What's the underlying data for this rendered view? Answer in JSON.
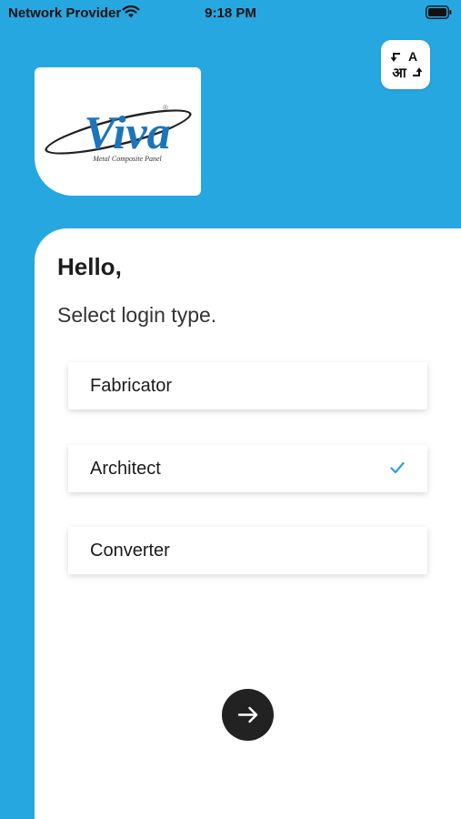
{
  "status_bar": {
    "carrier": "Network Provider",
    "time": "9:18 PM"
  },
  "colors": {
    "brand_blue": "#27a7e0",
    "check_blue": "#2e9ee0",
    "dark_button": "#222222"
  },
  "language_toggle": {
    "icon": "translate-icon",
    "glyph_latin": "A",
    "glyph_devanagari": "आ"
  },
  "logo": {
    "brand": "Viva",
    "tagline": "Metal Composite Panel",
    "trademark": "®"
  },
  "main": {
    "greeting": "Hello,",
    "subtitle": "Select login type.",
    "options": [
      {
        "label": "Fabricator",
        "selected": false
      },
      {
        "label": "Architect",
        "selected": true
      },
      {
        "label": "Converter",
        "selected": false
      }
    ],
    "next_icon": "arrow-right-icon"
  }
}
